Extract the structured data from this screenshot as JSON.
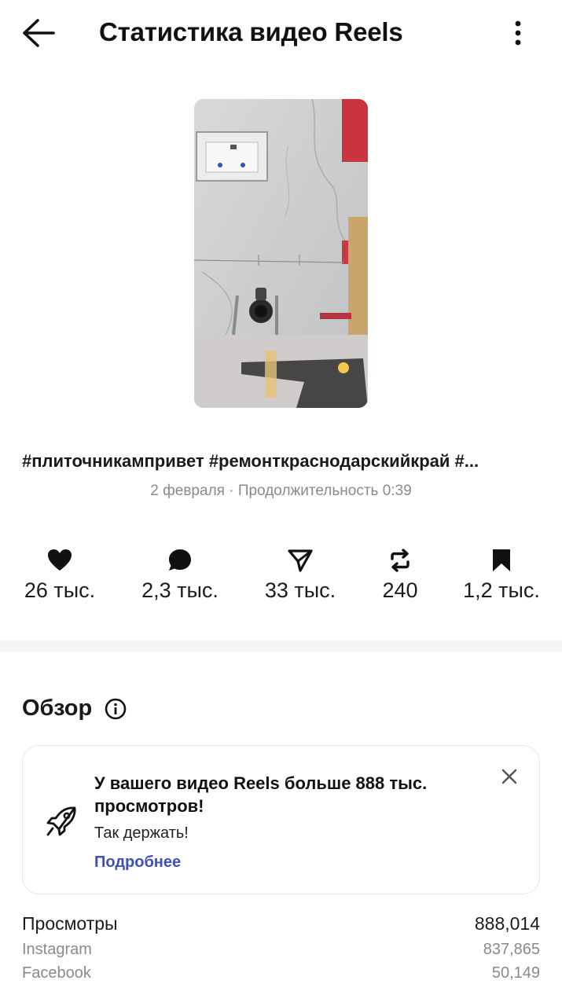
{
  "header": {
    "title": "Статистика видео Reels"
  },
  "post": {
    "caption": "#плиточникампривет #ремонткраснодарскийкрай #...",
    "meta": "2 февраля · Продолжительность 0:39"
  },
  "stats": {
    "likes": "26 тыс.",
    "comments": "2,3 тыс.",
    "shares": "33 тыс.",
    "reposts": "240",
    "saves": "1,2 тыс."
  },
  "overview": {
    "title": "Обзор",
    "card": {
      "title": "У вашего видео Reels больше 888 тыс. просмотров!",
      "text": "Так держать!",
      "link": "Подробнее"
    }
  },
  "views": {
    "label": "Просмотры",
    "total": "888,014",
    "breakdown": [
      {
        "label": "Instagram",
        "value": "837,865"
      },
      {
        "label": "Facebook",
        "value": "50,149"
      }
    ]
  },
  "colors": {
    "link": "#3f51b5",
    "muted": "#8a8a8a",
    "divider": "#f5f5f5"
  }
}
